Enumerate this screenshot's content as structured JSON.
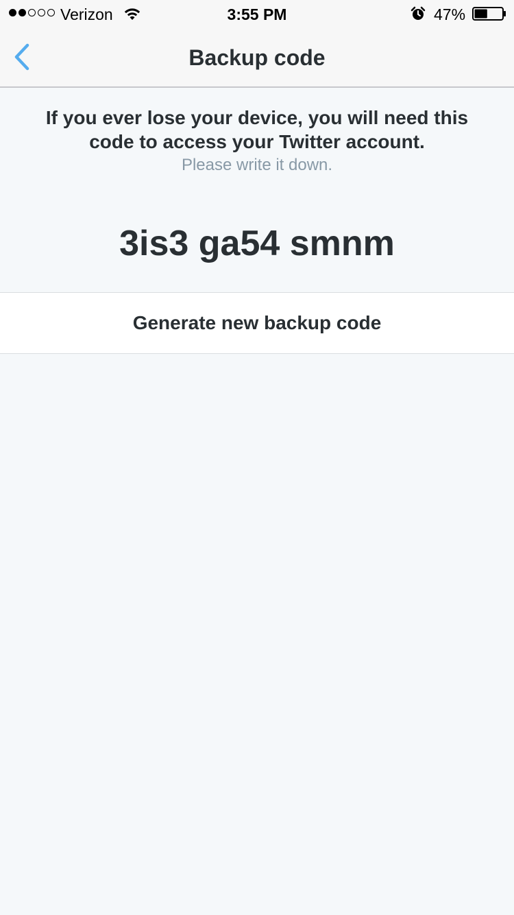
{
  "status_bar": {
    "carrier": "Verizon",
    "signal_strength": 2,
    "signal_max": 5,
    "time": "3:55 PM",
    "battery_percent": "47%",
    "battery_level": 0.47
  },
  "nav": {
    "title": "Backup code",
    "back_icon": "chevron-left-icon",
    "accent_color": "#55acee"
  },
  "content": {
    "intro_line1": "If you ever lose your device, you will need this",
    "intro_line2": "code to access your Twitter account.",
    "hint": "Please write it down.",
    "code": "3is3 ga54 smnm"
  },
  "actions": {
    "generate_label": "Generate new backup code"
  }
}
